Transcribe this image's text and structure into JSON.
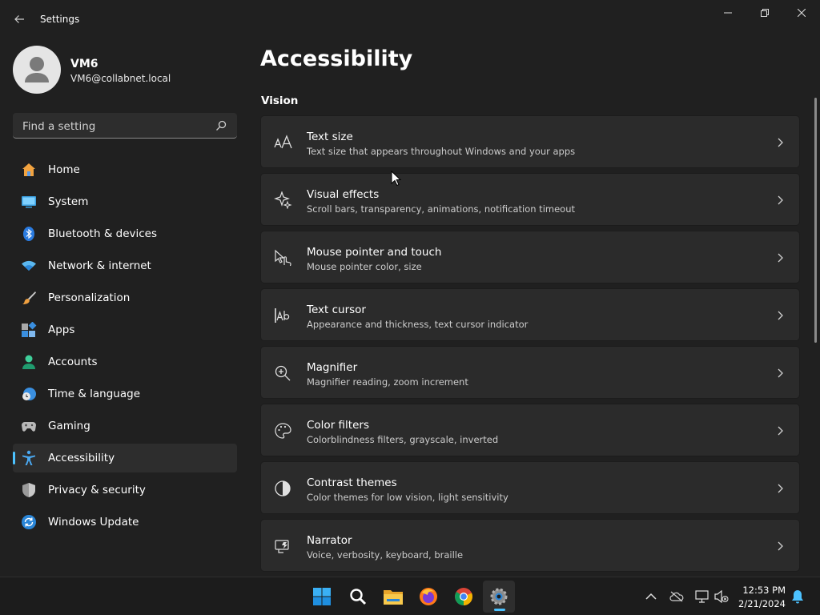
{
  "window": {
    "title": "Settings"
  },
  "user": {
    "name": "VM6",
    "email": "VM6@collabnet.local"
  },
  "search": {
    "placeholder": "Find a setting",
    "value": ""
  },
  "sidebar": {
    "selected": "Accessibility",
    "items": [
      {
        "label": "Home",
        "icon": "home-icon"
      },
      {
        "label": "System",
        "icon": "system-icon"
      },
      {
        "label": "Bluetooth & devices",
        "icon": "bluetooth-icon"
      },
      {
        "label": "Network & internet",
        "icon": "wifi-icon"
      },
      {
        "label": "Personalization",
        "icon": "brush-icon"
      },
      {
        "label": "Apps",
        "icon": "apps-icon"
      },
      {
        "label": "Accounts",
        "icon": "accounts-icon"
      },
      {
        "label": "Time & language",
        "icon": "clock-globe-icon"
      },
      {
        "label": "Gaming",
        "icon": "gamepad-icon"
      },
      {
        "label": "Accessibility",
        "icon": "accessibility-icon"
      },
      {
        "label": "Privacy & security",
        "icon": "shield-icon"
      },
      {
        "label": "Windows Update",
        "icon": "update-icon"
      }
    ]
  },
  "main": {
    "title": "Accessibility",
    "section": "Vision",
    "cards": [
      {
        "title": "Text size",
        "subtitle": "Text size that appears throughout Windows and your apps",
        "icon": "text-size-icon"
      },
      {
        "title": "Visual effects",
        "subtitle": "Scroll bars, transparency, animations, notification timeout",
        "icon": "visual-effects-icon"
      },
      {
        "title": "Mouse pointer and touch",
        "subtitle": "Mouse pointer color, size",
        "icon": "pointer-touch-icon"
      },
      {
        "title": "Text cursor",
        "subtitle": "Appearance and thickness, text cursor indicator",
        "icon": "text-cursor-icon"
      },
      {
        "title": "Magnifier",
        "subtitle": "Magnifier reading, zoom increment",
        "icon": "magnifier-icon"
      },
      {
        "title": "Color filters",
        "subtitle": "Colorblindness filters, grayscale, inverted",
        "icon": "palette-icon"
      },
      {
        "title": "Contrast themes",
        "subtitle": "Color themes for low vision, light sensitivity",
        "icon": "contrast-icon"
      },
      {
        "title": "Narrator",
        "subtitle": "Voice, verbosity, keyboard, braille",
        "icon": "narrator-icon"
      }
    ]
  },
  "taskbar": {
    "apps": [
      "start-icon",
      "search-icon",
      "file-explorer-icon",
      "firefox-icon",
      "chrome-icon",
      "settings-gear-icon"
    ],
    "tray": [
      "chevron-up-icon",
      "onedrive-icon",
      "network-icon",
      "speaker-muted-icon",
      "notification-bell-icon"
    ],
    "time": "12:53 PM",
    "date": "2/21/2024"
  },
  "colors": {
    "accent": "#4cc2ff",
    "background": "#202020",
    "card": "#2b2b2b"
  }
}
